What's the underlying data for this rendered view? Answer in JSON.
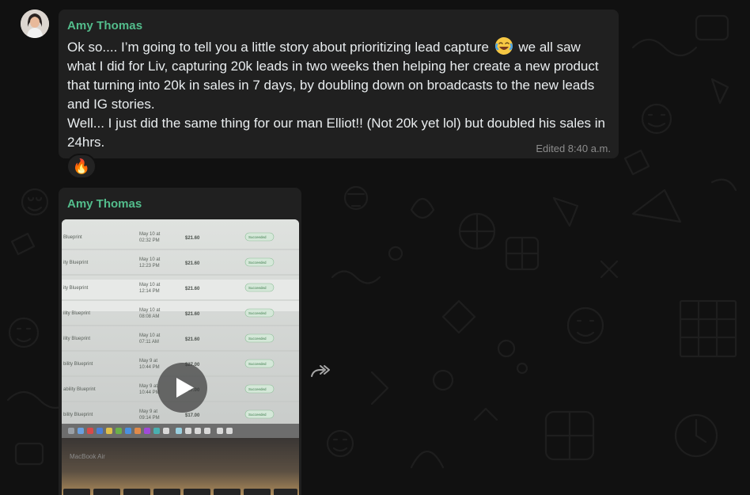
{
  "message1": {
    "sender": "Amy Thomas",
    "text_before_emoji": "Ok so.... I’m going to tell you a little story about prioritizing lead capture",
    "emoji_icon": "face-with-tears-of-joy-icon",
    "text_after_emoji": " we all saw what I did for Liv, capturing 20k leads in two weeks then helping her create a new product that turning into 20k in sales in 7 days, by doubling down on broadcasts to the new leads and IG stories.\nWell... I just did the same thing for our man Elliot!! (Not 20k yet lol) but doubled his sales in 24hrs.",
    "meta": "Edited 8:40 a.m.",
    "reaction": "🔥"
  },
  "message2": {
    "sender": "Amy Thomas",
    "video": {
      "rows": [
        {
          "name": "Blueprint",
          "date": "May 10 at",
          "time": "02:32 PM",
          "amount": "$21.60",
          "status": "Succeeded"
        },
        {
          "name": "ity Blueprint",
          "date": "May 10 at",
          "time": "12:23 PM",
          "amount": "$21.60",
          "status": "Succeeded"
        },
        {
          "name": "ity Blueprint",
          "date": "May 10 at",
          "time": "12:14 PM",
          "amount": "$21.60",
          "status": "Succeeded"
        },
        {
          "name": "ility Blueprint",
          "date": "May 10 at",
          "time": "08:08 AM",
          "amount": "$21.60",
          "status": "Succeeded"
        },
        {
          "name": "ility Blueprint",
          "date": "May 10 at",
          "time": "07:11 AM",
          "amount": "$21.60",
          "status": "Succeeded"
        },
        {
          "name": "bility Blueprint",
          "date": "May 9 at",
          "time": "10:44 PM",
          "amount": "$27.00",
          "status": "Succeeded"
        },
        {
          "name": "ability Blueprint",
          "date": "May 9 at",
          "time": "10:44 PM",
          "amount": "$27.00",
          "status": "Succeeded"
        },
        {
          "name": "bility Blueprint",
          "date": "May 9 at",
          "time": "09:14 PM",
          "amount": "$17.00",
          "status": "Succeeded"
        }
      ],
      "laptop_label": "MacBook Air"
    }
  },
  "colors": {
    "background": "#111111",
    "bubble": "#202020",
    "sender": "#53bd8c",
    "text": "#e9edef",
    "meta": "#8c8c8c"
  },
  "icons": [
    "avatar-photo",
    "fire-emoji",
    "play-icon",
    "forward-icon",
    "face-with-tears-of-joy-icon"
  ]
}
